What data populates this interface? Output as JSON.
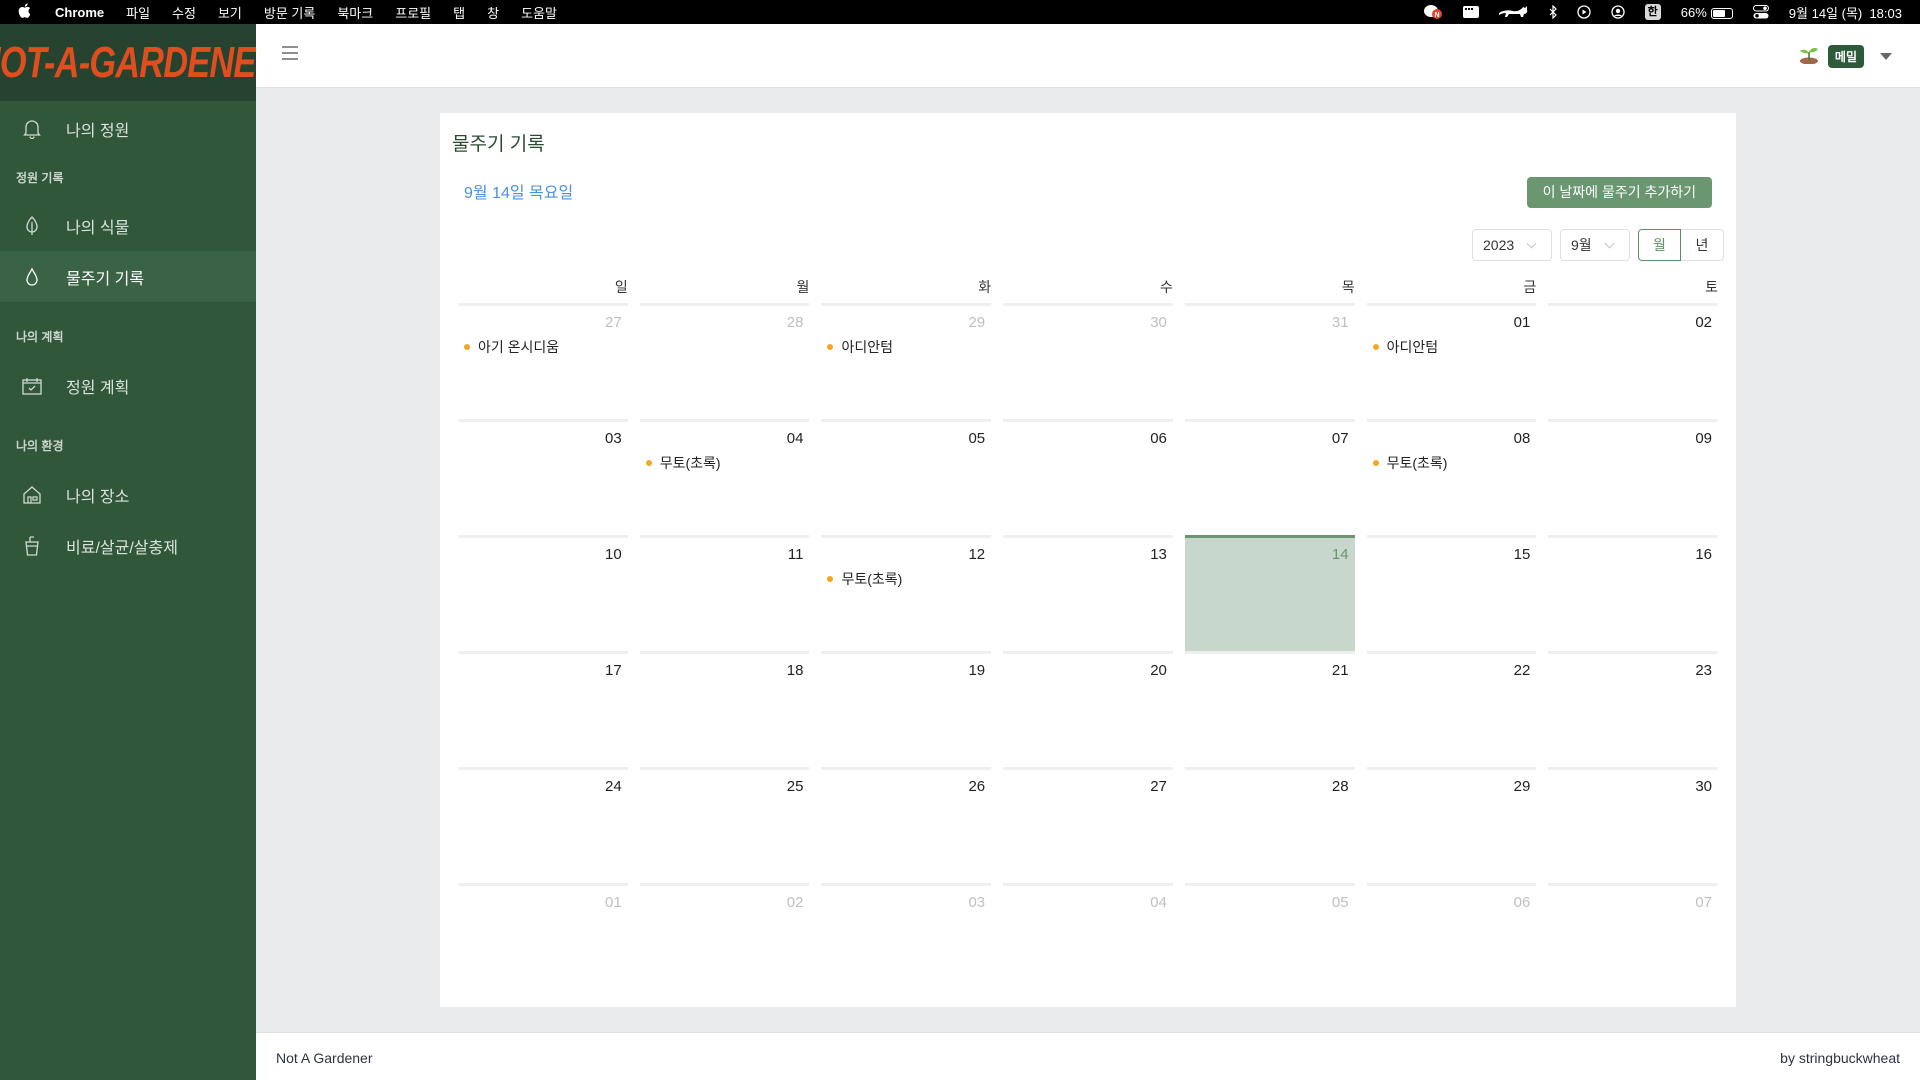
{
  "menubar": {
    "apple": "",
    "app": "Chrome",
    "menus": [
      "파일",
      "수정",
      "보기",
      "방문 기록",
      "북마크",
      "프로필",
      "탭",
      "창",
      "도움말"
    ],
    "status_icons": [
      "notification-icon",
      "display-icon",
      "cat-icon",
      "bluetooth-icon",
      "play-icon",
      "user-circle-icon"
    ],
    "input_method": "한",
    "battery_percent": "66%",
    "battery_level": 0.66,
    "datetime": "9월 14일 (목)  18:03"
  },
  "sidebar": {
    "logo": "NOT-A-GARDENER",
    "items": [
      {
        "label": "나의 정원",
        "icon": "bell-icon"
      },
      {
        "section": "정원 기록"
      },
      {
        "label": "나의 식물",
        "icon": "leaf-icon"
      },
      {
        "label": "물주기 기록",
        "icon": "water-drop-icon",
        "active": true
      },
      {
        "section": "나의 계획"
      },
      {
        "label": "정원 계획",
        "icon": "calendar-check-icon"
      },
      {
        "section": "나의 환경"
      },
      {
        "label": "나의 장소",
        "icon": "house-icon"
      },
      {
        "label": "비료/살균/살충제",
        "icon": "cup-icon"
      }
    ]
  },
  "topbar": {
    "user_badge": "메밀",
    "user_avatar": "sprout-icon"
  },
  "page": {
    "title": "물주기 기록",
    "selected_date": "9월 14일 목요일",
    "add_button": "이 날짜에 물주기 추가하기",
    "year_select": "2023",
    "month_select": "9월",
    "view_month": "월",
    "view_year": "년",
    "active_view": "월"
  },
  "calendar": {
    "weekdays": [
      "일",
      "월",
      "화",
      "수",
      "목",
      "금",
      "토"
    ],
    "today": "14",
    "weeks": [
      [
        {
          "d": "27",
          "o": true,
          "e": [
            "아기 온시디움"
          ]
        },
        {
          "d": "28",
          "o": true
        },
        {
          "d": "29",
          "o": true,
          "e": [
            "아디안텀"
          ]
        },
        {
          "d": "30",
          "o": true
        },
        {
          "d": "31",
          "o": true
        },
        {
          "d": "01",
          "e": [
            "아디안텀"
          ]
        },
        {
          "d": "02"
        }
      ],
      [
        {
          "d": "03"
        },
        {
          "d": "04",
          "e": [
            "무토(초록)"
          ]
        },
        {
          "d": "05"
        },
        {
          "d": "06"
        },
        {
          "d": "07"
        },
        {
          "d": "08",
          "e": [
            "무토(초록)"
          ]
        },
        {
          "d": "09"
        }
      ],
      [
        {
          "d": "10"
        },
        {
          "d": "11"
        },
        {
          "d": "12",
          "e": [
            "무토(초록)"
          ]
        },
        {
          "d": "13"
        },
        {
          "d": "14",
          "today": true
        },
        {
          "d": "15"
        },
        {
          "d": "16"
        }
      ],
      [
        {
          "d": "17"
        },
        {
          "d": "18"
        },
        {
          "d": "19"
        },
        {
          "d": "20"
        },
        {
          "d": "21"
        },
        {
          "d": "22"
        },
        {
          "d": "23"
        }
      ],
      [
        {
          "d": "24"
        },
        {
          "d": "25"
        },
        {
          "d": "26"
        },
        {
          "d": "27"
        },
        {
          "d": "28"
        },
        {
          "d": "29"
        },
        {
          "d": "30"
        }
      ],
      [
        {
          "d": "01",
          "o": true
        },
        {
          "d": "02",
          "o": true
        },
        {
          "d": "03",
          "o": true
        },
        {
          "d": "04",
          "o": true
        },
        {
          "d": "05",
          "o": true
        },
        {
          "d": "06",
          "o": true
        },
        {
          "d": "07",
          "o": true
        }
      ]
    ]
  },
  "footer": {
    "left": "Not A Gardener",
    "right": "by stringbuckwheat"
  },
  "colors": {
    "sidebar": "#31573a",
    "logo_bg": "#26432f",
    "logo_text": "#e04d1f",
    "accent": "#6a9670",
    "today_bg": "#c8d7cb",
    "event_dot": "#f5a623",
    "date_link": "#4a90e2"
  }
}
